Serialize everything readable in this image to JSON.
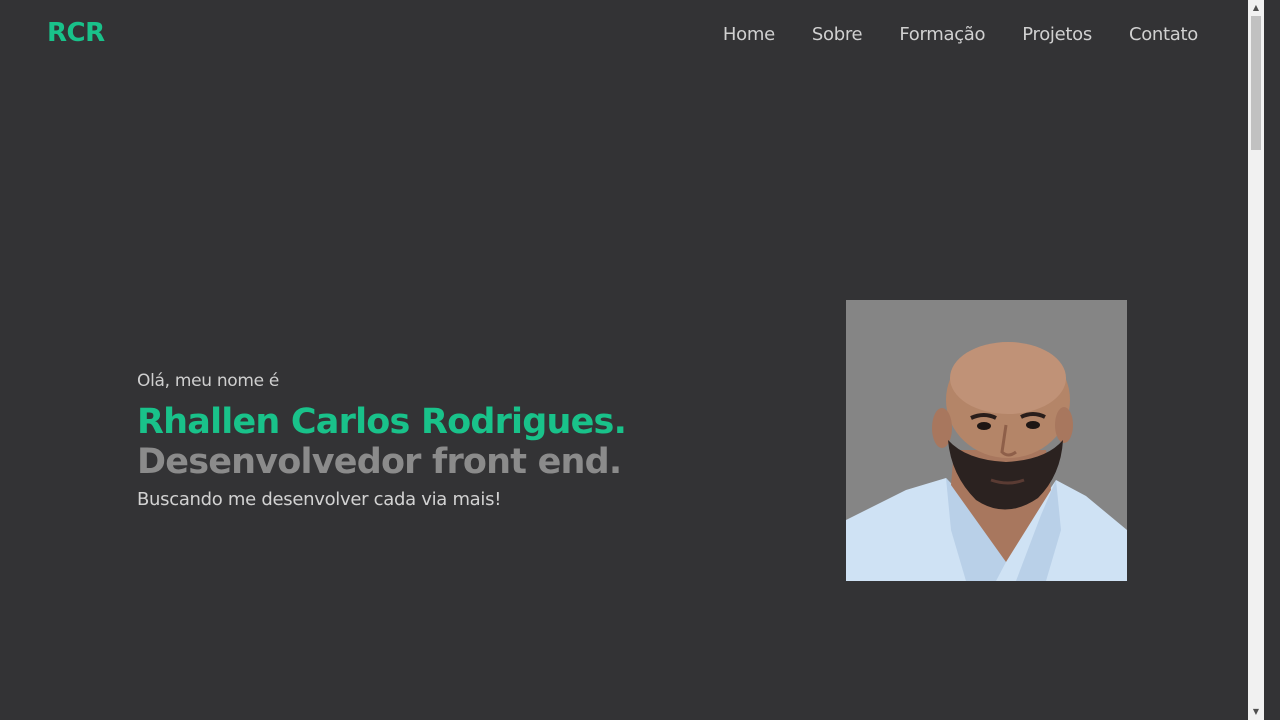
{
  "header": {
    "logo": "RCR",
    "nav": [
      "Home",
      "Sobre",
      "Formação",
      "Projetos",
      "Contato"
    ]
  },
  "hero": {
    "greeting": "Olá, meu nome é",
    "name": "Rhallen Carlos Rodrigues.",
    "role": "Desenvolvedor front end.",
    "tagline": "Buscando me desenvolver cada via mais!"
  },
  "colors": {
    "background": "#333335",
    "accent": "#19c28a",
    "muted": "#8b8b8b"
  },
  "icons": {
    "scroll_up": "triangle-up-icon",
    "scroll_down": "triangle-down-icon"
  }
}
